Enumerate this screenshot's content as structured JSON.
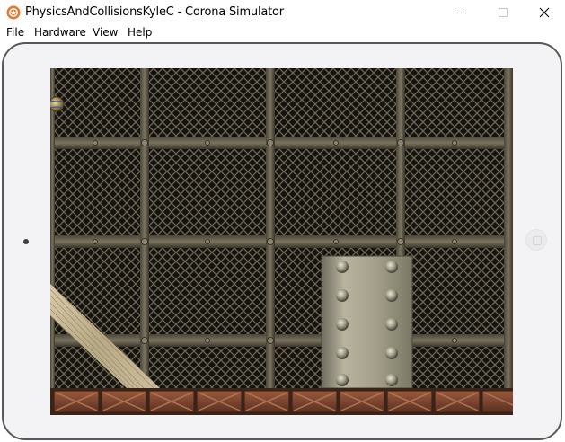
{
  "window": {
    "title": "PhysicsAndCollisionsKyleC - Corona Simulator",
    "app_icon": "corona-icon",
    "controls": [
      "minimize-icon",
      "maximize-icon",
      "close-icon"
    ]
  },
  "menu": {
    "file": "File",
    "hardware": "Hardware",
    "view": "View",
    "help": "Help"
  },
  "device": {
    "type": "tablet-landscape",
    "frame_color": "#f3f3f5",
    "border_color": "#585858"
  },
  "scene": {
    "background": "metal-mesh-grate",
    "objects": [
      "wooden-plank-ramp",
      "riveted-metal-block",
      "crate-floor",
      "ball"
    ]
  },
  "colors": {
    "icon_orange": "#e8762a",
    "crate_brown": "#7a4530",
    "metal_block": "#a8a390",
    "plank": "#cbbd9c"
  }
}
